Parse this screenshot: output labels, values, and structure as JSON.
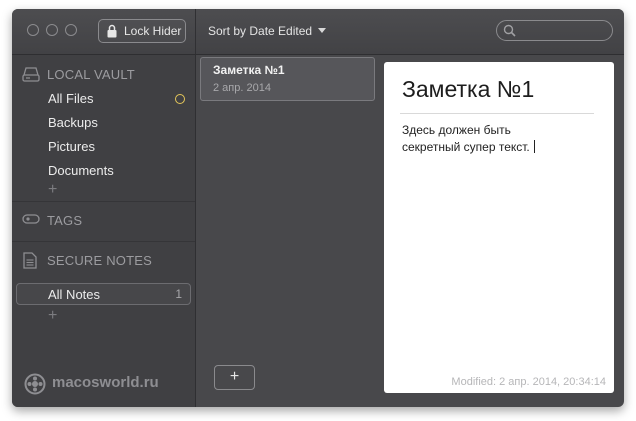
{
  "toolbar": {
    "lock_label": "Lock Hider",
    "sort_label": "Sort by Date Edited",
    "search_placeholder": ""
  },
  "sidebar": {
    "local_vault": {
      "title": "LOCAL VAULT",
      "items": [
        {
          "label": "All Files"
        },
        {
          "label": "Backups"
        },
        {
          "label": "Pictures"
        },
        {
          "label": "Documents"
        }
      ],
      "add": "+"
    },
    "tags": {
      "title": "TAGS"
    },
    "secure_notes": {
      "title": "SECURE NOTES",
      "items": [
        {
          "label": "All Notes",
          "count": "1"
        }
      ],
      "add": "+"
    },
    "brand": "macosworld.ru"
  },
  "notes_list": {
    "notes": [
      {
        "title": "Заметка №1",
        "date": "2 апр. 2014"
      }
    ],
    "add": "+"
  },
  "editor": {
    "title": "Заметка №1",
    "body_line1": "Здесь должен быть",
    "body_line2": "секретный супер текст.",
    "modified": "Modified: 2 апр. 2014, 20:34:14"
  },
  "colors": {
    "sidebar_bg": "#404043",
    "list_bg": "#48484b",
    "accent_dot": "#e4c65a"
  },
  "icons": [
    "lock-icon",
    "search-icon",
    "drive-icon",
    "tag-icon",
    "note-icon",
    "globe-logo-icon"
  ]
}
